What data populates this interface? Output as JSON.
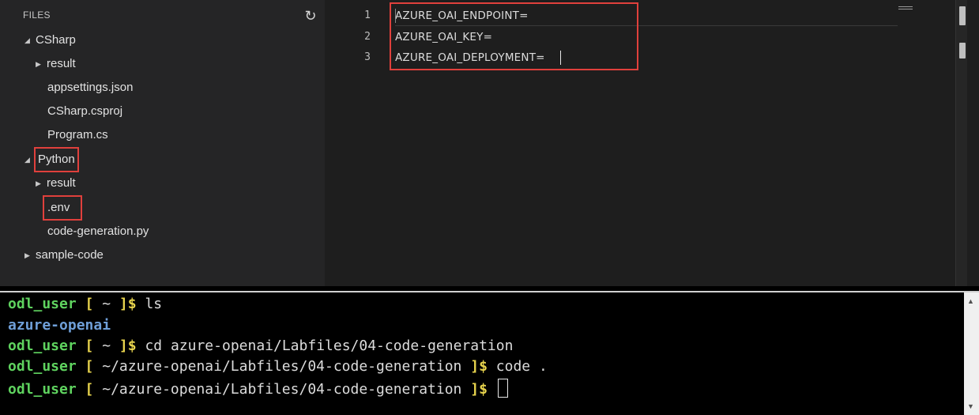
{
  "sidebar": {
    "title": "FILES",
    "refresh_icon": "refresh-icon",
    "tree": [
      {
        "label": "CSharp",
        "expanded": true,
        "level": 0
      },
      {
        "label": "result",
        "expanded": false,
        "level": 1
      },
      {
        "label": "appsettings.json",
        "level": 2
      },
      {
        "label": "CSharp.csproj",
        "level": 2
      },
      {
        "label": "Program.cs",
        "level": 2
      },
      {
        "label": "Python",
        "expanded": true,
        "level": 0,
        "highlighted": true
      },
      {
        "label": "result",
        "expanded": false,
        "level": 1
      },
      {
        "label": ".env",
        "level": 2,
        "highlighted": true
      },
      {
        "label": "code-generation.py",
        "level": 2
      },
      {
        "label": "sample-code",
        "expanded": false,
        "level": 0
      }
    ]
  },
  "editor": {
    "line_numbers": [
      "1",
      "2",
      "3"
    ],
    "lines": [
      "AZURE_OAI_ENDPOINT=",
      "AZURE_OAI_KEY=",
      "AZURE_OAI_DEPLOYMENT="
    ]
  },
  "terminal": {
    "lines": [
      {
        "user": "odl_user",
        "path": "~",
        "command": "ls"
      },
      {
        "output": "azure-openai"
      },
      {
        "user": "odl_user",
        "path": "~",
        "command": "cd azure-openai/Labfiles/04-code-generation"
      },
      {
        "user": "odl_user",
        "path": "~/azure-openai/Labfiles/04-code-generation",
        "command": "code ."
      },
      {
        "user": "odl_user",
        "path": "~/azure-openai/Labfiles/04-code-generation",
        "command": ""
      }
    ]
  },
  "colors": {
    "highlight_box": "#e0403c",
    "prompt_user": "#5fd35f",
    "prompt_bracket": "#e8d44d",
    "directory": "#6f9fd8"
  }
}
